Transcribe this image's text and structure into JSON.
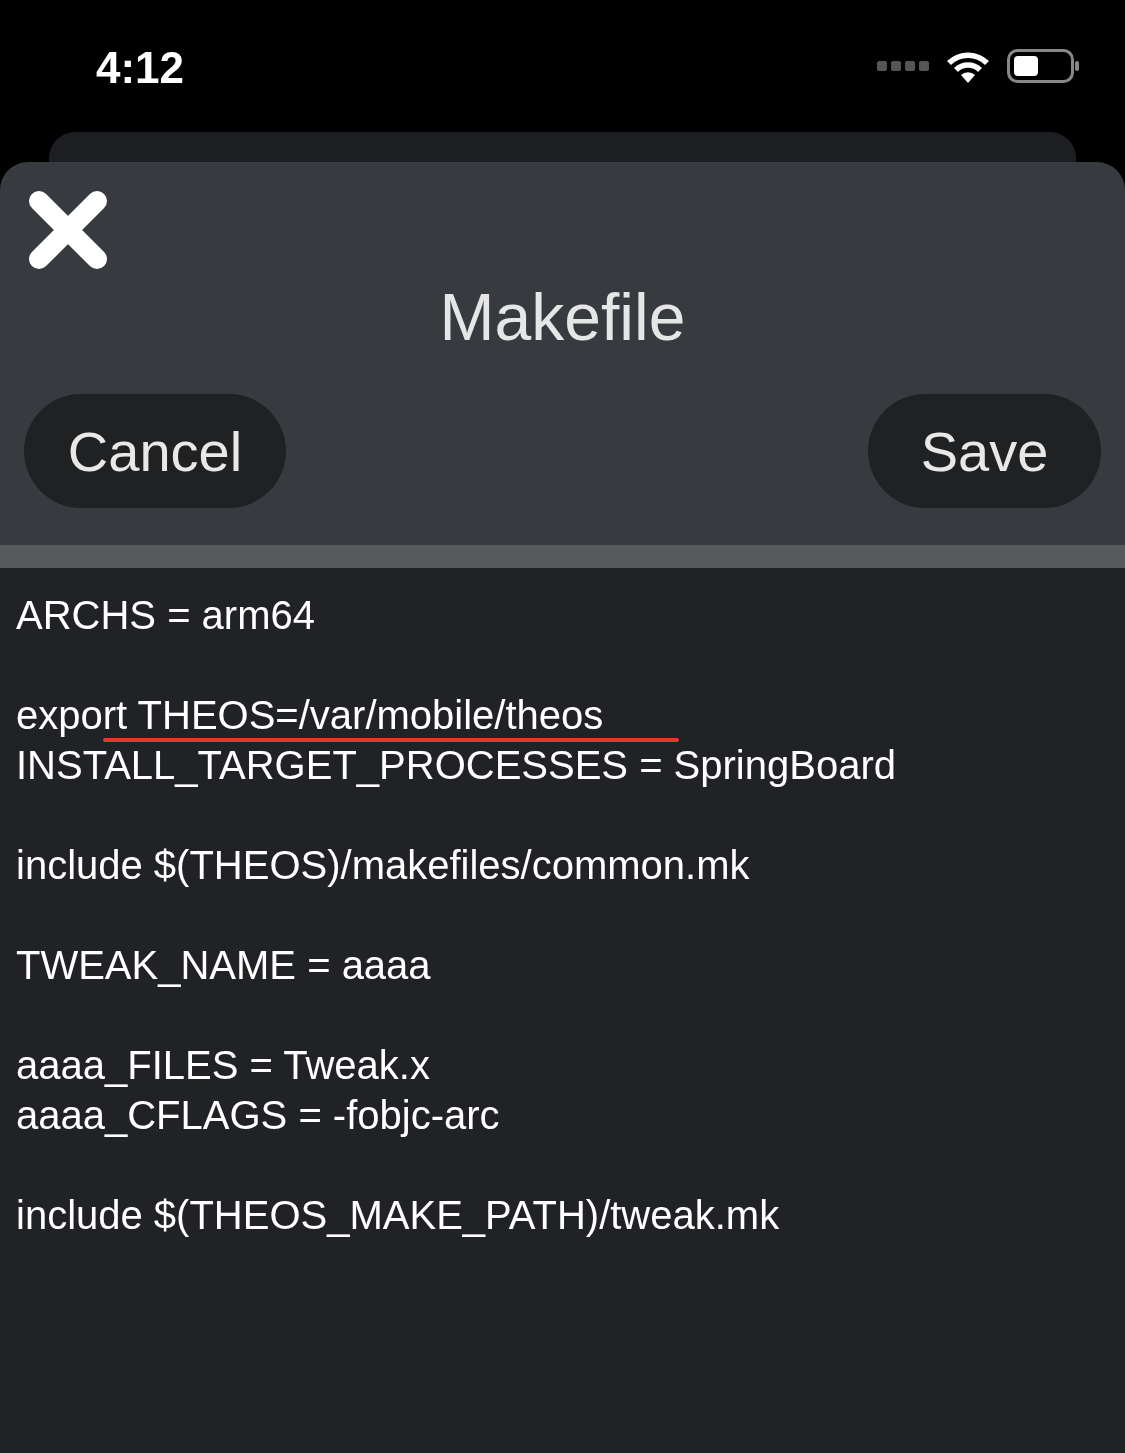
{
  "status_bar": {
    "time": "4:12"
  },
  "sheet": {
    "title": "Makefile",
    "left_button": "Cancel",
    "right_button": "Save"
  },
  "editor": {
    "blocks": [
      [
        {
          "text": "ARCHS = arm64",
          "underlined": false
        }
      ],
      [
        {
          "text": "export THEOS=/var/mobile/theos",
          "underlined": true
        },
        {
          "text": "INSTALL_TARGET_PROCESSES = SpringBoard",
          "underlined": false
        }
      ],
      [
        {
          "text": "include $(THEOS)/makefiles/common.mk",
          "underlined": false
        }
      ],
      [
        {
          "text": "TWEAK_NAME = aaaa",
          "underlined": false
        }
      ],
      [
        {
          "text": "aaaa_FILES = Tweak.x",
          "underlined": false
        },
        {
          "text": "aaaa_CFLAGS = -fobjc-arc",
          "underlined": false
        }
      ],
      [
        {
          "text": "include $(THEOS_MAKE_PATH)/tweak.mk",
          "underlined": false
        }
      ]
    ]
  }
}
